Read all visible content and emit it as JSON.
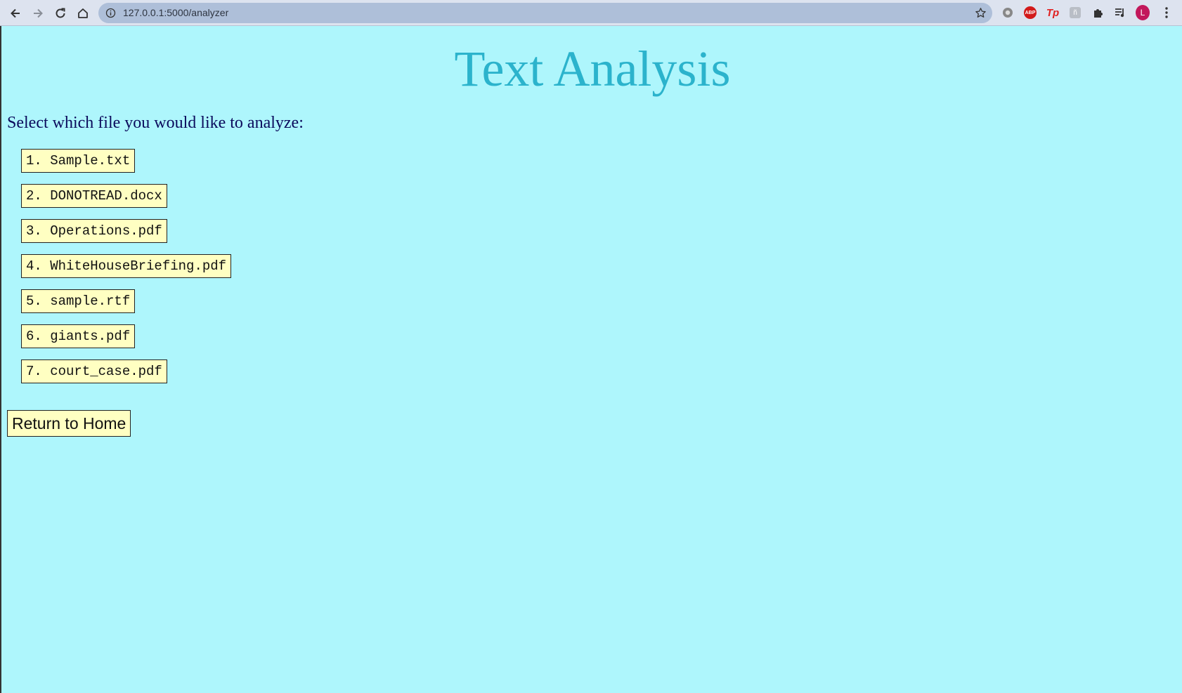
{
  "browser": {
    "url": "127.0.0.1:5000/analyzer",
    "extensions": {
      "abp_label": "ABP",
      "tp_label": "Tp",
      "grey_label": "ñ",
      "avatar_letter": "L"
    }
  },
  "page": {
    "title": "Text Analysis",
    "prompt": "Select which file you would like to analyze:",
    "files": [
      "1. Sample.txt",
      "2. DONOTREAD.docx",
      "3. Operations.pdf",
      "4. WhiteHouseBriefing.pdf",
      "5. sample.rtf",
      "6. giants.pdf",
      "7. court_case.pdf"
    ],
    "return_label": "Return to Home"
  },
  "colors": {
    "page_background": "#aef6fc",
    "title": "#2bb3cc",
    "prompt": "#0b0b5c",
    "button_background": "#ffffc2"
  }
}
